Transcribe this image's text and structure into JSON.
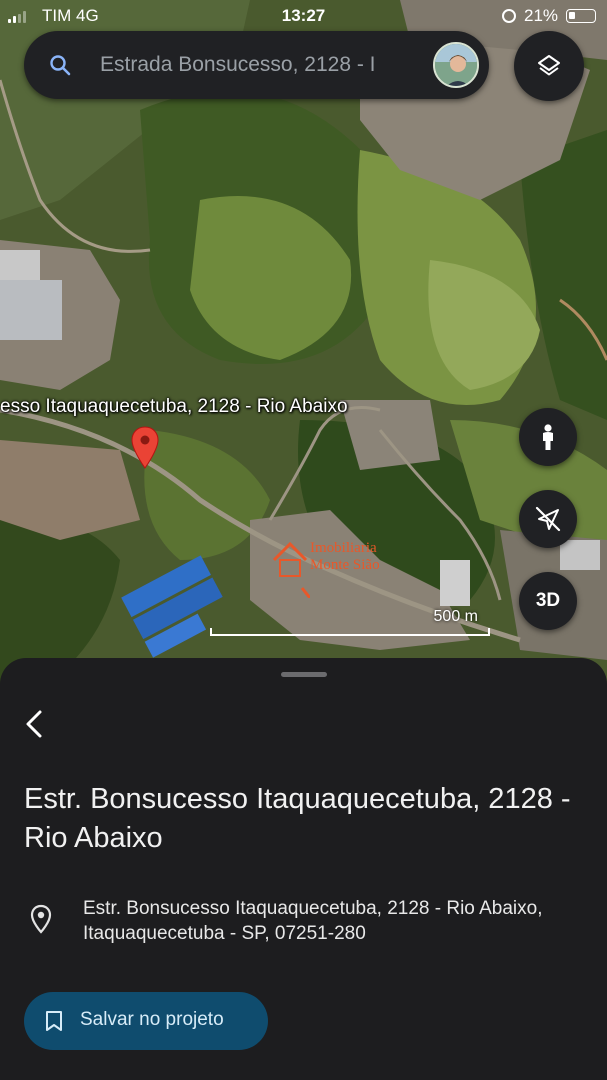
{
  "status_bar": {
    "carrier": "TIM",
    "network": "4G",
    "time": "13:27",
    "battery": "21%"
  },
  "search": {
    "value": "Estrada Bonsucesso, 2128 - I"
  },
  "map": {
    "place_label": "esso Itaquaquecetuba, 2128 - Rio Abaixo",
    "watermark_line1": "Imobiliaria",
    "watermark_line2": "Monte Sião",
    "scale_label": "500 m",
    "btn_3d": "3D",
    "icons": [
      "search-icon",
      "layers-icon",
      "pegman-icon",
      "compass-off-icon",
      "location-pin-icon"
    ]
  },
  "place": {
    "title": "Estr. Bonsucesso Itaquaquecetuba, 2128 - Rio Abaixo",
    "address": "Estr. Bonsucesso Itaquaquecetuba, 2128 - Rio Abaixo, Itaquaquecetuba - SP, 07251-280",
    "save_button": "Salvar no projeto"
  },
  "colors": {
    "sheet_bg": "#1d1d1f",
    "button_bg": "#0f4c6e",
    "pin": "#ea4335",
    "watermark": "#e8582a"
  }
}
